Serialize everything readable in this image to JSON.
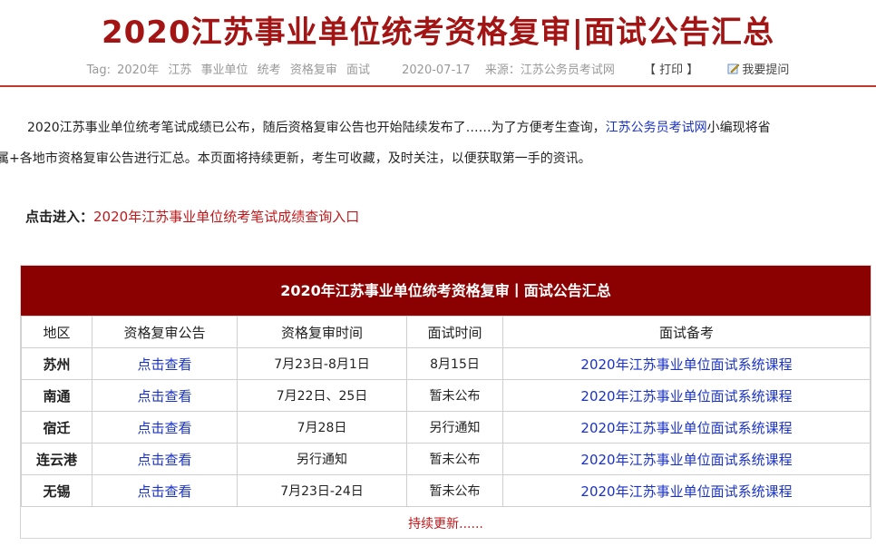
{
  "header": {
    "title": "2020江苏事业单位统考资格复审|面试公告汇总",
    "tag_label": "Tag:",
    "tags": [
      "2020年",
      "江苏",
      "事业单位",
      "统考",
      "资格复审",
      "面试"
    ],
    "date": "2020-07-17",
    "source_label": "来源：江苏公务员考试网",
    "print_label": "【 打印 】",
    "ask_label": "我要提问"
  },
  "intro": {
    "line1_a": "2020江苏事业单位统考笔试成绩已公布，随后资格复审公告也开始陆续发布了……为了方便考生查询，",
    "line1_link": "江苏公务员考试网",
    "line1_b": "小编现将省",
    "line2": "属+各地市资格复审公告进行汇总。本页面将持续更新，考生可收藏，及时关注，以便获取第一手的资讯。"
  },
  "entry": {
    "label": "点击进入：",
    "link": "2020年江苏事业单位统考笔试成绩查询入口"
  },
  "table": {
    "title": "2020年江苏事业单位统考资格复审丨面试公告汇总",
    "columns": [
      "地区",
      "资格复审公告",
      "资格复审时间",
      "面试时间",
      "面试备考"
    ],
    "rows": [
      {
        "region": "苏州",
        "notice": "点击查看",
        "review_time": "7月23日-8月1日",
        "interview_time": "8月15日",
        "prep": "2020年江苏事业单位面试系统课程"
      },
      {
        "region": "南通",
        "notice": "点击查看",
        "review_time": "7月22日、25日",
        "interview_time": "暂未公布",
        "prep": "2020年江苏事业单位面试系统课程"
      },
      {
        "region": "宿迁",
        "notice": "点击查看",
        "review_time": "7月28日",
        "interview_time": "另行通知",
        "prep": "2020年江苏事业单位面试系统课程"
      },
      {
        "region": "连云港",
        "notice": "点击查看",
        "review_time": "另行通知",
        "interview_time": "暂未公布",
        "prep": "2020年江苏事业单位面试系统课程"
      },
      {
        "region": "无锡",
        "notice": "点击查看",
        "review_time": "7月23日-24日",
        "interview_time": "暂未公布",
        "prep": "2020年江苏事业单位面试系统课程"
      }
    ],
    "footer": "持续更新......"
  },
  "colors": {
    "title_red": "#a31515",
    "table_header_bg": "#8b0000",
    "link_blue": "#1a33c5",
    "link_red": "#c0181a"
  }
}
